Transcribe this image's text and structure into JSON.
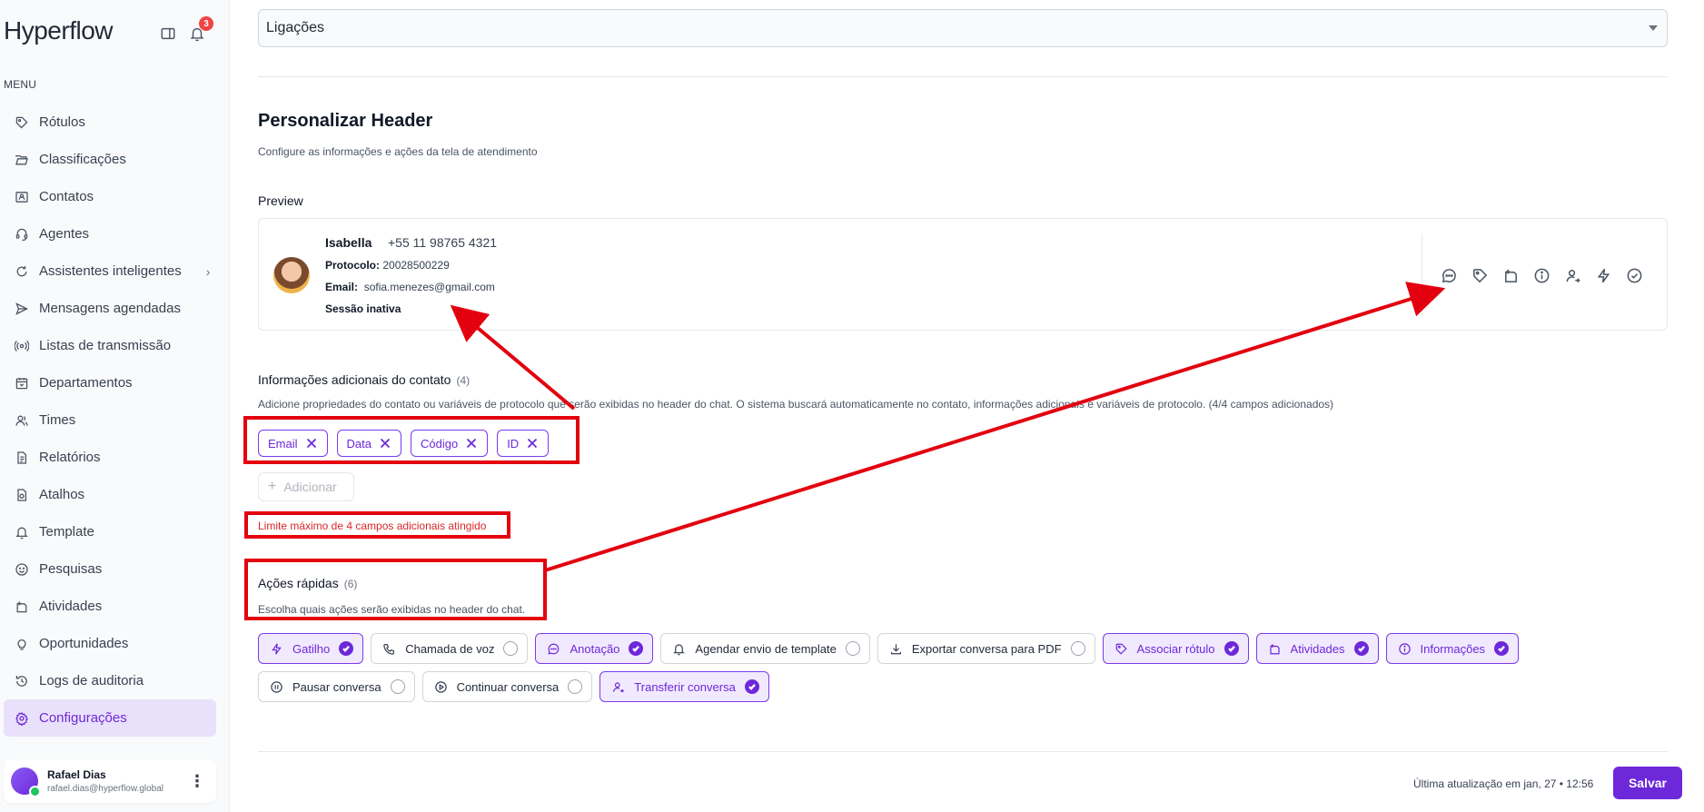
{
  "app": {
    "logo_text": "Hyperflow",
    "notification_count": "3",
    "menu_title": "MENU"
  },
  "sidebar": {
    "items": [
      {
        "label": "Rótulos",
        "icon": "tag-icon"
      },
      {
        "label": "Classificações",
        "icon": "folder-open-icon"
      },
      {
        "label": "Contatos",
        "icon": "contact-card-icon"
      },
      {
        "label": "Agentes",
        "icon": "headset-icon"
      },
      {
        "label": "Assistentes inteligentes",
        "icon": "refresh-bot-icon"
      },
      {
        "label": "Mensagens agendadas",
        "icon": "send-icon"
      },
      {
        "label": "Listas de transmissão",
        "icon": "broadcast-icon"
      },
      {
        "label": "Departamentos",
        "icon": "calendar-icon"
      },
      {
        "label": "Times",
        "icon": "team-icon"
      },
      {
        "label": "Relatórios",
        "icon": "report-icon"
      },
      {
        "label": "Atalhos",
        "icon": "shortcut-doc-icon"
      },
      {
        "label": "Template",
        "icon": "bell-icon"
      },
      {
        "label": "Pesquisas",
        "icon": "smiley-icon"
      },
      {
        "label": "Atividades",
        "icon": "activities-icon"
      },
      {
        "label": "Oportunidades",
        "icon": "lightbulb-icon"
      },
      {
        "label": "Logs de auditoria",
        "icon": "history-icon"
      },
      {
        "label": "Configurações",
        "icon": "gear-icon"
      }
    ],
    "active_index": 16,
    "expandable_index": 4,
    "expand_glyph": "›"
  },
  "user": {
    "name": "Rafael Dias",
    "email": "rafael.dias@hyperflow.global",
    "more_glyph": "⋮"
  },
  "main": {
    "channel_select": "Ligações",
    "title": "Personalizar Header",
    "subtitle": "Configure as informações e ações da tela de atendimento",
    "preview_label": "Preview"
  },
  "preview": {
    "name": "Isabella",
    "phone": "+55 11 98765 4321",
    "protocol_label": "Protocolo:",
    "protocol_value": "20028500229",
    "email_label": "Email:",
    "email_value": "sofia.menezes@gmail.com",
    "session": "Sessão inativa",
    "actions": [
      "chat-bubble-icon",
      "tag-icon",
      "activities-icon",
      "info-icon",
      "user-transfer-icon",
      "bolt-icon",
      "check-circle-icon"
    ]
  },
  "additional_info": {
    "title": "Informações adicionais do contato",
    "count": "(4)",
    "description": "Adicione propriedades do contato ou variáveis de protocolo que serão exibidas no header do chat. O sistema buscará automaticamente no contato, informações adicionais e variáveis de protocolo. (4/4 campos adicionados)",
    "chips": [
      "Email",
      "Data",
      "Código",
      "ID"
    ],
    "add_label": "Adicionar",
    "limit_message": "Limite máximo de 4 campos adicionais atingido"
  },
  "quick_actions": {
    "title": "Ações rápidas",
    "count": "(6)",
    "description": "Escolha quais ações serão exibidas no header do chat.",
    "rows": [
      [
        {
          "label": "Gatilho",
          "icon": "bolt-icon",
          "checked": true
        },
        {
          "label": "Chamada de voz",
          "icon": "phone-icon",
          "checked": false
        },
        {
          "label": "Anotação",
          "icon": "chat-bubble-icon",
          "checked": true
        },
        {
          "label": "Agendar envio de template",
          "icon": "bell-icon",
          "checked": false
        },
        {
          "label": "Exportar conversa para PDF",
          "icon": "download-icon",
          "checked": false
        },
        {
          "label": "Associar rótulo",
          "icon": "tag-icon",
          "checked": true
        },
        {
          "label": "Atividades",
          "icon": "activities-icon",
          "checked": true
        },
        {
          "label": "Informações",
          "icon": "info-icon",
          "checked": true
        }
      ],
      [
        {
          "label": "Pausar conversa",
          "icon": "pause-circle-icon",
          "checked": false
        },
        {
          "label": "Continuar conversa",
          "icon": "play-circle-icon",
          "checked": false
        },
        {
          "label": "Transferir conversa",
          "icon": "user-transfer-icon",
          "checked": true
        }
      ]
    ]
  },
  "footer": {
    "last_update": "Última atualização em jan, 27 • 12:56",
    "save_label": "Salvar"
  },
  "colors": {
    "accent": "#6d28d9",
    "annotation": "#e3000f",
    "error": "#dc2626"
  }
}
